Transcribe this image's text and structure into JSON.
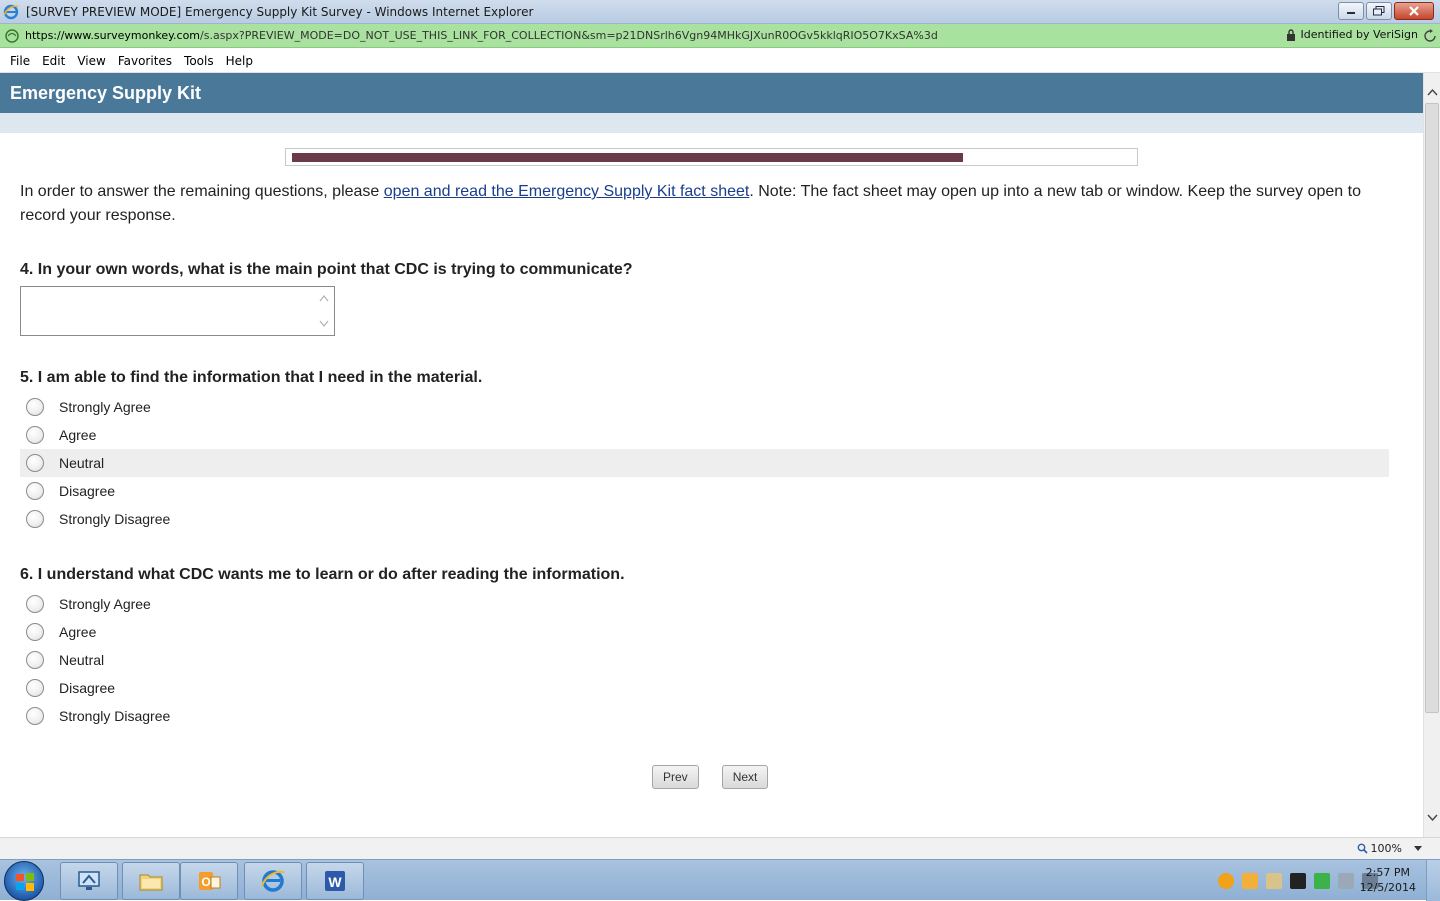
{
  "window": {
    "title": "[SURVEY PREVIEW MODE] Emergency Supply Kit Survey - Windows Internet Explorer"
  },
  "address": {
    "url_host": "https://www.surveymonkey.com",
    "url_rest": "/s.aspx?PREVIEW_MODE=DO_NOT_USE_THIS_LINK_FOR_COLLECTION&sm=p21DNSrlh6Vgn94MHkGJXunR0OGv5kklqRIO5O7KxSA%3d",
    "security_label": "Identified by VeriSign"
  },
  "menu": [
    "File",
    "Edit",
    "View",
    "Favorites",
    "Tools",
    "Help"
  ],
  "survey": {
    "title": "Emergency Supply Kit",
    "progress_fraction": 0.8,
    "intro_before": "In order to answer the remaining questions, please ",
    "intro_link": "open and read the Emergency Supply Kit fact sheet",
    "intro_after": ". Note: The fact sheet may open up into a new tab or window. Keep the survey open to record your response.",
    "q4": {
      "title": "4. In your own words, what is the main point that CDC is trying to communicate?",
      "value": ""
    },
    "q5": {
      "title": "5. I am able to find the information that I need in the material.",
      "options": [
        "Strongly Agree",
        "Agree",
        "Neutral",
        "Disagree",
        "Strongly Disagree"
      ]
    },
    "q6": {
      "title": "6. I understand what CDC wants me to learn or do after reading the information.",
      "options": [
        "Strongly Agree",
        "Agree",
        "Neutral",
        "Disagree",
        "Strongly Disagree"
      ]
    },
    "buttons": {
      "prev": "Prev",
      "next": "Next"
    }
  },
  "statusbar": {
    "zoom": "100%"
  },
  "clock": {
    "time": "2:57 PM",
    "date": "12/5/2014"
  },
  "colors": {
    "header": "#4a7898",
    "progress": "#6a3a4a",
    "link": "#1a3d8f",
    "address_secure": "#a9e29f"
  }
}
